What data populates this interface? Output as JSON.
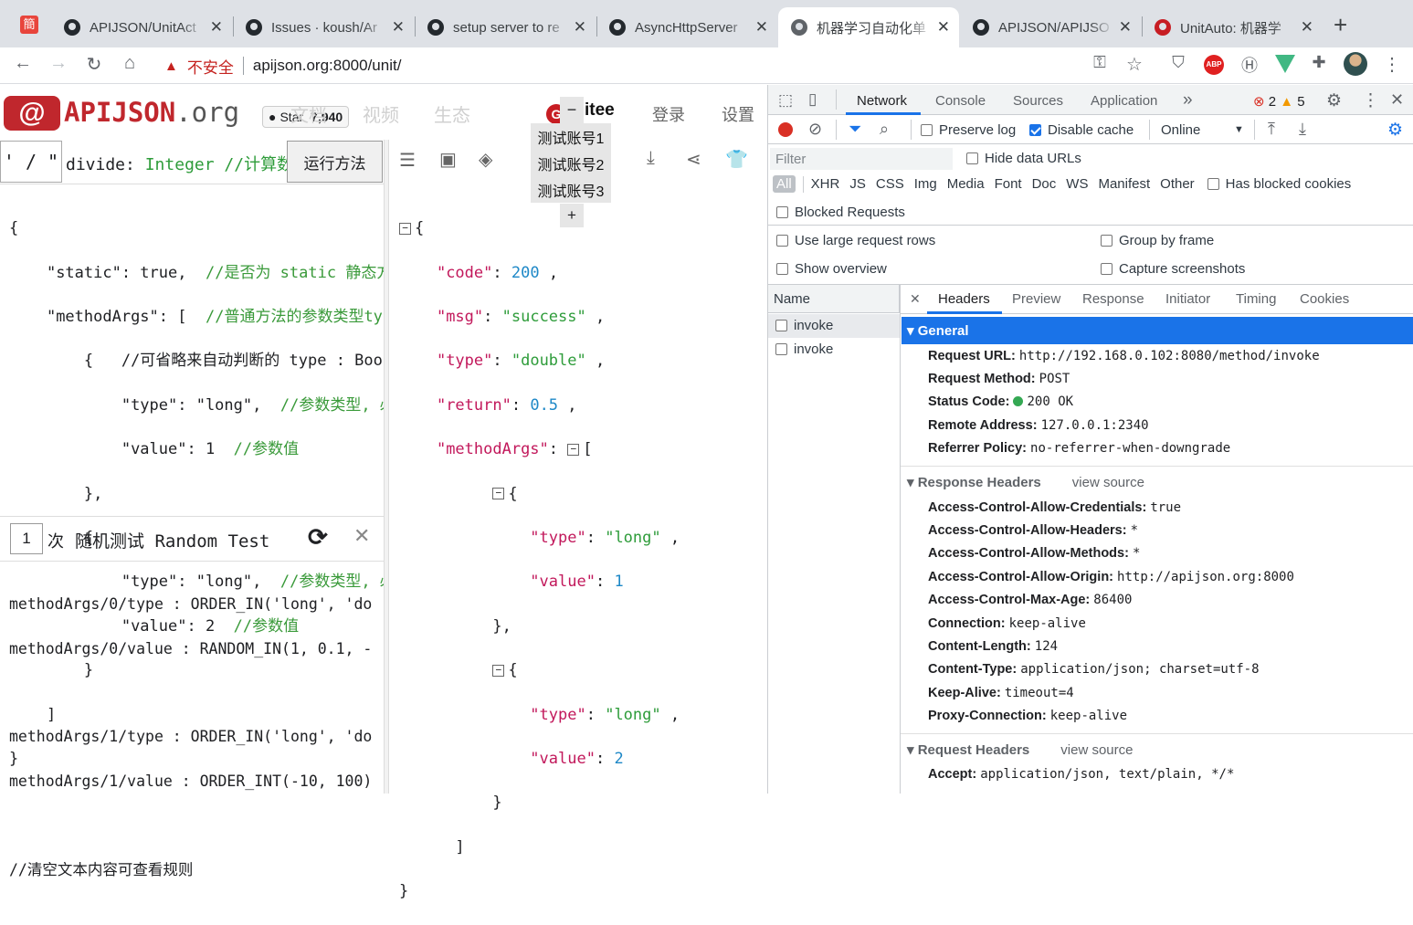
{
  "browser": {
    "tabs": [
      {
        "title": "APIJSON/UnitAct",
        "active": false
      },
      {
        "title": "Issues · koush/Ar",
        "active": false
      },
      {
        "title": "setup server to re",
        "active": false
      },
      {
        "title": "AsyncHttpServer",
        "active": false
      },
      {
        "title": "机器学习自动化单",
        "active": true
      },
      {
        "title": "APIJSON/APIJSO",
        "active": false
      },
      {
        "title": "UnitAuto: 机器学",
        "active": false
      }
    ],
    "first_tab_icon": "簡",
    "insecure_label": "不安全",
    "url": "apijson.org:8000/unit/"
  },
  "app": {
    "brand": "APIJSON",
    "brand_suffix": ".org",
    "star_label": "Star",
    "star_count": "7,940",
    "nav_docs": "文档",
    "nav_video": "视频",
    "nav_ecosystem": "生态",
    "gitee_label": "itee",
    "login": "登录",
    "settings": "设置",
    "accounts": [
      "测试账号1",
      "测试账号2",
      "测试账号3"
    ],
    "account_add": "+",
    "account_minus": "−",
    "method_op": "' / \"",
    "method_signature_name": "divide",
    "method_signature_type": "Integer",
    "method_signature_comment": "//计算数",
    "run_button": "运行方法",
    "random_count": "1",
    "random_unit": "次",
    "random_title": "随机测试 Random Test",
    "random_lines": [
      "methodArgs/0/type : ORDER_IN('long', 'do",
      "methodArgs/0/value : RANDOM_IN(1, 0.1, -",
      "",
      "methodArgs/1/type : ORDER_IN('long', 'do",
      "methodArgs/1/value : ORDER_INT(-10, 100)",
      "",
      "//清空文本内容可查看规则"
    ],
    "request": {
      "open": "{",
      "static_key": "\"static\": true,",
      "static_comment": "//是否为 static 静态方",
      "methodArgs_key": "\"methodArgs\": [",
      "methodArgs_comment": "//普通方法的参数类型ty",
      "arg_open_comment": "//可省略来自动判断的 type : Boo",
      "arg_type": "\"type\": \"long\",",
      "arg_type_comment": "//参数类型, 必",
      "arg1_value": "\"value\": 1",
      "arg2_value": "\"value\": 2",
      "arg_value_comment": "//参数值",
      "close": "}"
    },
    "response": {
      "code_key": "\"code\"",
      "code_val": "200",
      "msg_key": "\"msg\"",
      "msg_val": "\"success\"",
      "type_key": "\"type\"",
      "type_val": "\"double\"",
      "return_key": "\"return\"",
      "return_val": "0.5",
      "methodArgs_key": "\"methodArgs\"",
      "arg_type_key": "\"type\"",
      "arg_type_val": "\"long\"",
      "arg_value_key": "\"value\"",
      "arg1_value": "1",
      "arg2_value": "2"
    }
  },
  "devtools": {
    "tabs": [
      "Network",
      "Console",
      "Sources",
      "Application"
    ],
    "more": "»",
    "errors": "2",
    "warnings": "5",
    "preserve_log": "Preserve log",
    "disable_cache": "Disable cache",
    "throttle": "Online",
    "filter_placeholder": "Filter",
    "hide_data_urls": "Hide data URLs",
    "type_filters": [
      "All",
      "XHR",
      "JS",
      "CSS",
      "Img",
      "Media",
      "Font",
      "Doc",
      "WS",
      "Manifest",
      "Other"
    ],
    "has_blocked_cookies": "Has blocked cookies",
    "blocked_requests": "Blocked Requests",
    "use_large_rows": "Use large request rows",
    "group_by_frame": "Group by frame",
    "show_overview": "Show overview",
    "capture_screenshots": "Capture screenshots",
    "name_header": "Name",
    "requests": [
      "invoke",
      "invoke"
    ],
    "detail_tabs": [
      "Headers",
      "Preview",
      "Response",
      "Initiator",
      "Timing",
      "Cookies"
    ],
    "general_title": "General",
    "general": [
      {
        "k": "Request URL:",
        "v": "http://192.168.0.102:8080/method/invoke"
      },
      {
        "k": "Request Method:",
        "v": "POST"
      },
      {
        "k": "Status Code:",
        "v": "200 OK"
      },
      {
        "k": "Remote Address:",
        "v": "127.0.0.1:2340"
      },
      {
        "k": "Referrer Policy:",
        "v": "no-referrer-when-downgrade"
      }
    ],
    "response_headers_title": "Response Headers",
    "view_source": "view source",
    "response_headers": [
      {
        "k": "Access-Control-Allow-Credentials:",
        "v": "true"
      },
      {
        "k": "Access-Control-Allow-Headers:",
        "v": "*"
      },
      {
        "k": "Access-Control-Allow-Methods:",
        "v": "*"
      },
      {
        "k": "Access-Control-Allow-Origin:",
        "v": "http://apijson.org:8000"
      },
      {
        "k": "Access-Control-Max-Age:",
        "v": "86400"
      },
      {
        "k": "Connection:",
        "v": "keep-alive"
      },
      {
        "k": "Content-Length:",
        "v": "124"
      },
      {
        "k": "Content-Type:",
        "v": "application/json; charset=utf-8"
      },
      {
        "k": "Keep-Alive:",
        "v": "timeout=4"
      },
      {
        "k": "Proxy-Connection:",
        "v": "keep-alive"
      }
    ],
    "request_headers_title": "Request Headers",
    "request_headers": [
      {
        "k": "Accept:",
        "v": "application/json, text/plain, */*"
      }
    ]
  },
  "colors": {
    "brand": "#c0272d",
    "selected": "#1a73e8",
    "json_key": "#c2185b",
    "json_string": "#2e9c3a",
    "json_number": "#1e88c7"
  }
}
